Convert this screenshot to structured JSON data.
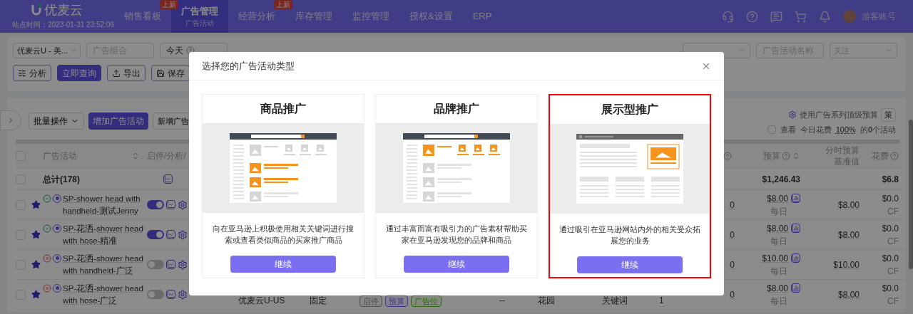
{
  "header": {
    "logo": "优麦云",
    "site_time": "站点时间：2023-01-31 23:52:06",
    "nav": [
      {
        "label": "销售看板",
        "selected": false,
        "badge": "上新"
      },
      {
        "label": "广告管理",
        "selected": true,
        "sub": "广告活动"
      },
      {
        "label": "经营分析",
        "selected": false,
        "badge": "上新"
      },
      {
        "label": "库存管理",
        "selected": false
      },
      {
        "label": "监控管理",
        "selected": false
      },
      {
        "label": "授权&设置",
        "selected": false
      },
      {
        "label": "ERP",
        "selected": false
      }
    ],
    "account": "游客账号"
  },
  "filters": {
    "left": [
      {
        "kind": "select",
        "value": "优麦云U - 美..."
      },
      {
        "kind": "input",
        "placeholder": "广告组合"
      },
      {
        "kind": "date",
        "value": "今天"
      }
    ],
    "right": [
      {
        "kind": "select"
      },
      {
        "kind": "input",
        "placeholder": "广告活动名称"
      },
      {
        "kind": "select",
        "placeholder": "关注"
      }
    ]
  },
  "actions": [
    {
      "label": "分析",
      "kind": "analyze"
    },
    {
      "label": "立即查询",
      "kind": "primary"
    },
    {
      "label": "导出",
      "kind": "export"
    },
    {
      "label": "保存",
      "kind": "save"
    }
  ],
  "toolbar": {
    "bulk": "批量操作",
    "add": "增加广告活动",
    "new_group": "新增广告",
    "budget_setting": "使用广告系列顶级预算",
    "budget_button": "策",
    "view": {
      "label": "查看",
      "checked": false
    },
    "today": "今日花费",
    "percent": "100%",
    "count": "的**0**个活动"
  },
  "table": {
    "all_checked": false,
    "columns": {
      "campaign": "广告活动",
      "ops": "启停/分析/",
      "budget": "预算",
      "base": [
        "分时预算",
        "基准值"
      ],
      "spend": "花费"
    },
    "total": {
      "checked": false,
      "label": "总计(178)",
      "budget": "$1,246.43",
      "spend": "$6.8"
    },
    "rows": [
      {
        "checked": false,
        "starred": true,
        "paused": false,
        "name": "SP-shower head with handheld-测试Jenny",
        "on": true,
        "count": "0",
        "budget": "$8.00",
        "period": "每日",
        "base": "$8.00",
        "spend": "$0.0",
        "spend_sub": "CF"
      },
      {
        "checked": false,
        "starred": true,
        "paused": false,
        "name": "SP-花洒-shower head with hose-精准",
        "on": true,
        "count": "0",
        "budget": "$8.00",
        "period": "每日",
        "base": "$8.00",
        "spend": "$0.0",
        "spend_sub": "CF"
      },
      {
        "checked": false,
        "starred": true,
        "paused": true,
        "name": "SP-花洒-shower head with handheld-广泛",
        "on": false,
        "count": "0",
        "budget": "$10.00",
        "period": "每日",
        "base": "$10.00",
        "spend": "$0.0",
        "spend_sub": "CF"
      },
      {
        "checked": false,
        "starred": true,
        "paused": true,
        "name": "SP-花洒-shower head with hose-广泛",
        "on": false,
        "store": "优麦云U-US",
        "type": "固定",
        "tags": [
          {
            "label": "启停",
            "kind": "neutral"
          },
          {
            "label": "预算",
            "kind": "budget"
          },
          {
            "label": "广告位",
            "kind": "placement"
          }
        ],
        "placement": "--",
        "keyword_group": "花园",
        "match": "关键词",
        "targets": "1",
        "count": "0",
        "budget": "$8.00",
        "period": "每日",
        "base": "$8.00",
        "spend": "$0.0",
        "spend_sub": "CF"
      }
    ]
  },
  "modal": {
    "title": "选择您的广告活动类型",
    "cards": [
      {
        "kind": "product",
        "title": "商品推广",
        "description": "向在亚马逊上积极使用相关关键词进行搜索或查看类似商品的买家推广商品",
        "button": "继续",
        "selected": false
      },
      {
        "kind": "brand",
        "title": "品牌推广",
        "description": "通过丰富而富有吸引力的广告素材帮助买家在亚马逊发现您的品牌和商品",
        "button": "继续",
        "selected": false
      },
      {
        "kind": "display",
        "title": "展示型推广",
        "description": "通过吸引在亚马逊网站内外的相关受众拓展您的业务",
        "button": "继续",
        "selected": true
      }
    ]
  }
}
